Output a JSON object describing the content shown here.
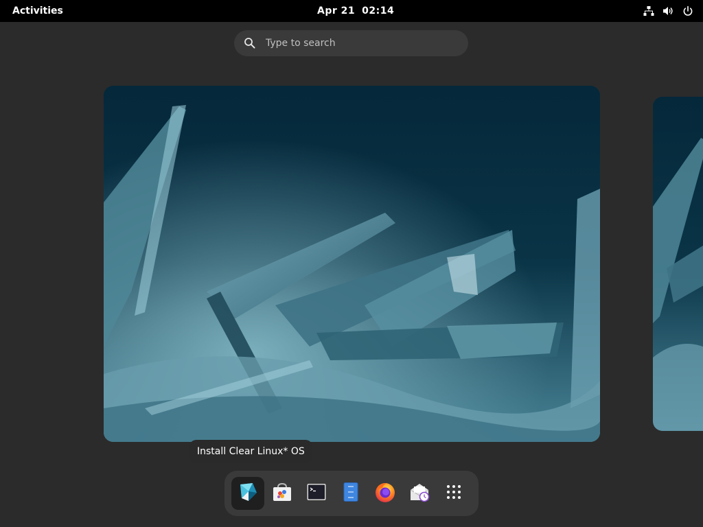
{
  "topbar": {
    "activities_label": "Activities",
    "date": "Apr 21",
    "time": "02:14",
    "tray": {
      "network_icon": "network-wired-icon",
      "volume_icon": "volume-icon",
      "power_icon": "power-icon"
    }
  },
  "search": {
    "placeholder": "Type to search",
    "value": "",
    "icon": "search-icon"
  },
  "workspaces": [
    {
      "name": "workspace-1",
      "wallpaper": "crystal wallpaper"
    },
    {
      "name": "workspace-2",
      "wallpaper": "crystal wallpaper"
    }
  ],
  "tooltip": {
    "text": "Install Clear Linux* OS"
  },
  "dash": {
    "items": [
      {
        "label": "Install Clear Linux* OS",
        "icon": "clear-linux-installer-icon",
        "active": true
      },
      {
        "label": "Software",
        "icon": "software-store-icon",
        "active": false
      },
      {
        "label": "Terminal",
        "icon": "terminal-icon",
        "active": false
      },
      {
        "label": "Files",
        "icon": "files-icon",
        "active": false
      },
      {
        "label": "Firefox",
        "icon": "firefox-icon",
        "active": false
      },
      {
        "label": "Mail",
        "icon": "mail-icon",
        "active": false
      },
      {
        "label": "Show Applications",
        "icon": "app-grid-icon",
        "active": false
      }
    ]
  },
  "colors": {
    "panel": "#000000",
    "background": "#2b2b2b",
    "search_bg": "#3a3a3a",
    "dash_bg": "#3a3a3a",
    "wallpaper_base": "#08303f"
  }
}
